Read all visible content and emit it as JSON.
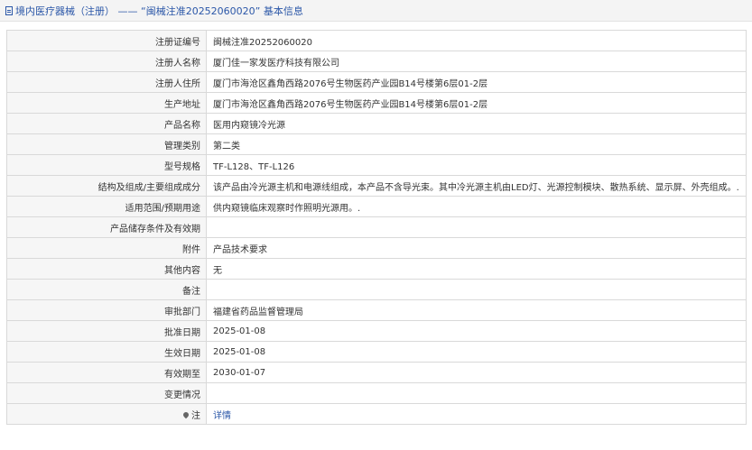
{
  "header": {
    "title": "境内医疗器械（注册） —— “闽械注准20252060020” 基本信息"
  },
  "rows": [
    {
      "label": "注册证编号",
      "value": "闽械注准20252060020"
    },
    {
      "label": "注册人名称",
      "value": "厦门佳一家发医疗科技有限公司"
    },
    {
      "label": "注册人住所",
      "value": "厦门市海沧区鑫角西路2076号生物医药产业园B14号楼第6层01-2层"
    },
    {
      "label": "生产地址",
      "value": "厦门市海沧区鑫角西路2076号生物医药产业园B14号楼第6层01-2层"
    },
    {
      "label": "产品名称",
      "value": "医用内窥镜冷光源"
    },
    {
      "label": "管理类别",
      "value": "第二类"
    },
    {
      "label": "型号规格",
      "value": "TF-L128、TF-L126"
    },
    {
      "label": "结构及组成/主要组成成分",
      "value": "该产品由冷光源主机和电源线组成，本产品不含导光束。其中冷光源主机由LED灯、光源控制模块、散热系统、显示屏、外壳组成。."
    },
    {
      "label": "适用范围/预期用途",
      "value": "供内窥镜临床观察时作照明光源用。."
    },
    {
      "label": "产品储存条件及有效期",
      "value": ""
    },
    {
      "label": "附件",
      "value": "产品技术要求"
    },
    {
      "label": "其他内容",
      "value": "无"
    },
    {
      "label": "备注",
      "value": ""
    },
    {
      "label": "审批部门",
      "value": "福建省药品监督管理局"
    },
    {
      "label": "批准日期",
      "value": "2025-01-08"
    },
    {
      "label": "生效日期",
      "value": "2025-01-08"
    },
    {
      "label": "有效期至",
      "value": "2030-01-07"
    },
    {
      "label": "变更情况",
      "value": ""
    }
  ],
  "note": {
    "label": "注",
    "link_text": "详情"
  }
}
